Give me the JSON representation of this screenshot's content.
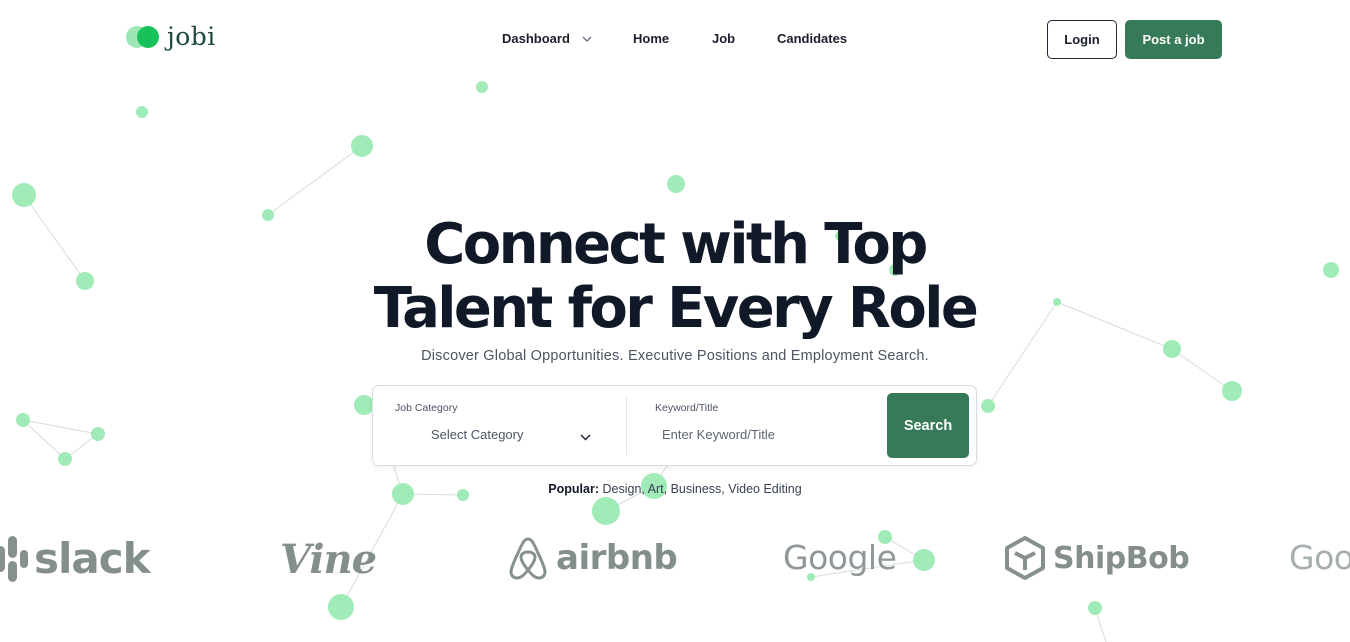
{
  "brand": {
    "name": "jobi",
    "accent": "#367a5a",
    "particle_color": "#8fe8aa"
  },
  "nav": {
    "items": [
      {
        "label": "Dashboard",
        "has_dropdown": true
      },
      {
        "label": "Home"
      },
      {
        "label": "Job"
      },
      {
        "label": "Candidates"
      }
    ],
    "login_label": "Login",
    "post_label": "Post a job"
  },
  "hero": {
    "title_line1": "Connect with Top",
    "title_line2": "Talent for Every Role",
    "subtitle": "Discover Global Opportunities. Executive Positions and Employment Search."
  },
  "search": {
    "category_label": "Job Category",
    "category_value": "Select Category",
    "keyword_label": "Keyword/Title",
    "keyword_placeholder": "Enter Keyword/Title",
    "button_label": "Search"
  },
  "popular": {
    "label": "Popular:",
    "items": "Design, Art, Business, Video Editing"
  },
  "partner_logos": [
    {
      "name": "slack",
      "icon": "slack-icon"
    },
    {
      "name": "Vine"
    },
    {
      "name": "airbnb",
      "icon": "airbnb-icon"
    },
    {
      "name": "Google"
    },
    {
      "name": "ShipBob",
      "icon": "shipbob-icon"
    },
    {
      "name": "Goo"
    }
  ]
}
